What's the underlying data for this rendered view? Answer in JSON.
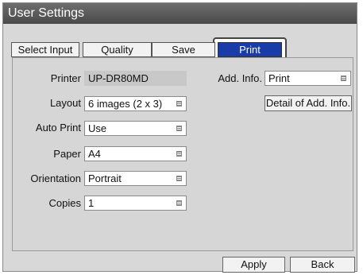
{
  "window": {
    "title": "User Settings"
  },
  "tabs": [
    {
      "label": "Select Input",
      "active": false
    },
    {
      "label": "Quality",
      "active": false
    },
    {
      "label": "Save",
      "active": false
    },
    {
      "label": "Print",
      "active": true
    }
  ],
  "form": {
    "printer": {
      "label": "Printer",
      "value": "UP-DR80MD"
    },
    "layout": {
      "label": "Layout",
      "value": "6 images (2 x 3)"
    },
    "auto_print": {
      "label": "Auto Print",
      "value": "Use"
    },
    "paper": {
      "label": "Paper",
      "value": "A4"
    },
    "orientation": {
      "label": "Orientation",
      "value": "Portrait"
    },
    "copies": {
      "label": "Copies",
      "value": "1"
    },
    "add_info": {
      "label": "Add. Info.",
      "value": "Print"
    },
    "detail_button": "Detail of Add. Info."
  },
  "footer": {
    "apply_label": "Apply",
    "back_label": "Back"
  },
  "colors": {
    "titlebar": "#4a4a4a",
    "active_tab": "#1a3ca8",
    "panel": "#d6d6d6"
  }
}
